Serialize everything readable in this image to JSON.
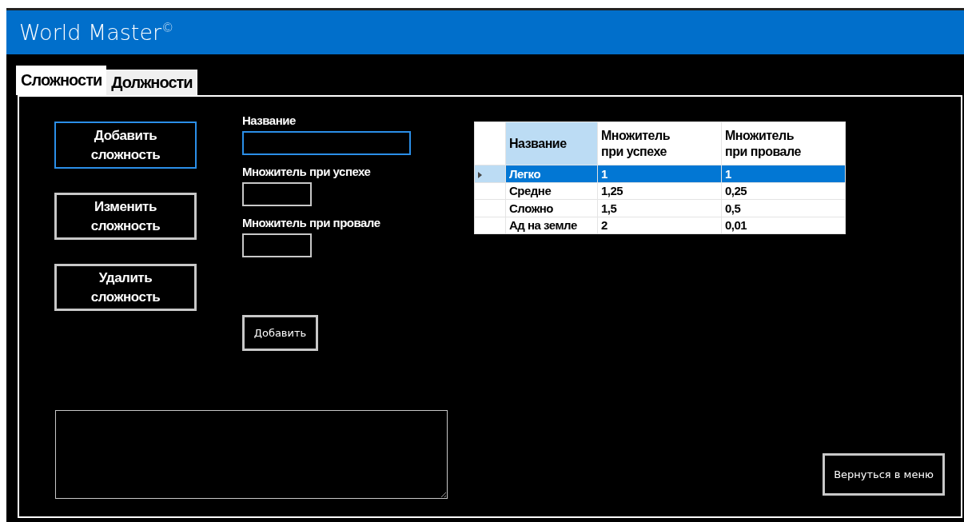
{
  "window": {
    "title": "World Master$^{©}$"
  },
  "tabs": [
    {
      "label": "Сложности",
      "selected": true
    },
    {
      "label": "Должности",
      "selected": false
    }
  ],
  "actions": [
    {
      "label": "Добавить сложность",
      "focused": true
    },
    {
      "label": "Изменить сложность",
      "focused": false
    },
    {
      "label": "Удалить сложность",
      "focused": false
    }
  ],
  "form": {
    "fields": [
      {
        "label": "Название",
        "kind": "wide",
        "focused": true
      },
      {
        "label": "Множитель при успехе",
        "kind": "narrow",
        "focused": false
      },
      {
        "label": "Множитель при провале",
        "kind": "narrow",
        "focused": false
      }
    ],
    "submit": "Добавить"
  },
  "table": {
    "columns": [
      {
        "label": "Название",
        "highlighted": true
      },
      {
        "label": "Множитель при успехе",
        "highlighted": false
      },
      {
        "label": "Множитель при провале",
        "highlighted": false
      }
    ],
    "rows": [
      {
        "cells": [
          "Легко",
          "1",
          "1"
        ],
        "selected": true
      },
      {
        "cells": [
          "Средне",
          "1,25",
          "0,25"
        ],
        "selected": false
      },
      {
        "cells": [
          "Сложно",
          "1,5",
          "0,5"
        ],
        "selected": false
      },
      {
        "cells": [
          "Ад на земле",
          "2",
          "0,01"
        ],
        "selected": false
      }
    ]
  },
  "back_button": "Вернуться в меню"
}
